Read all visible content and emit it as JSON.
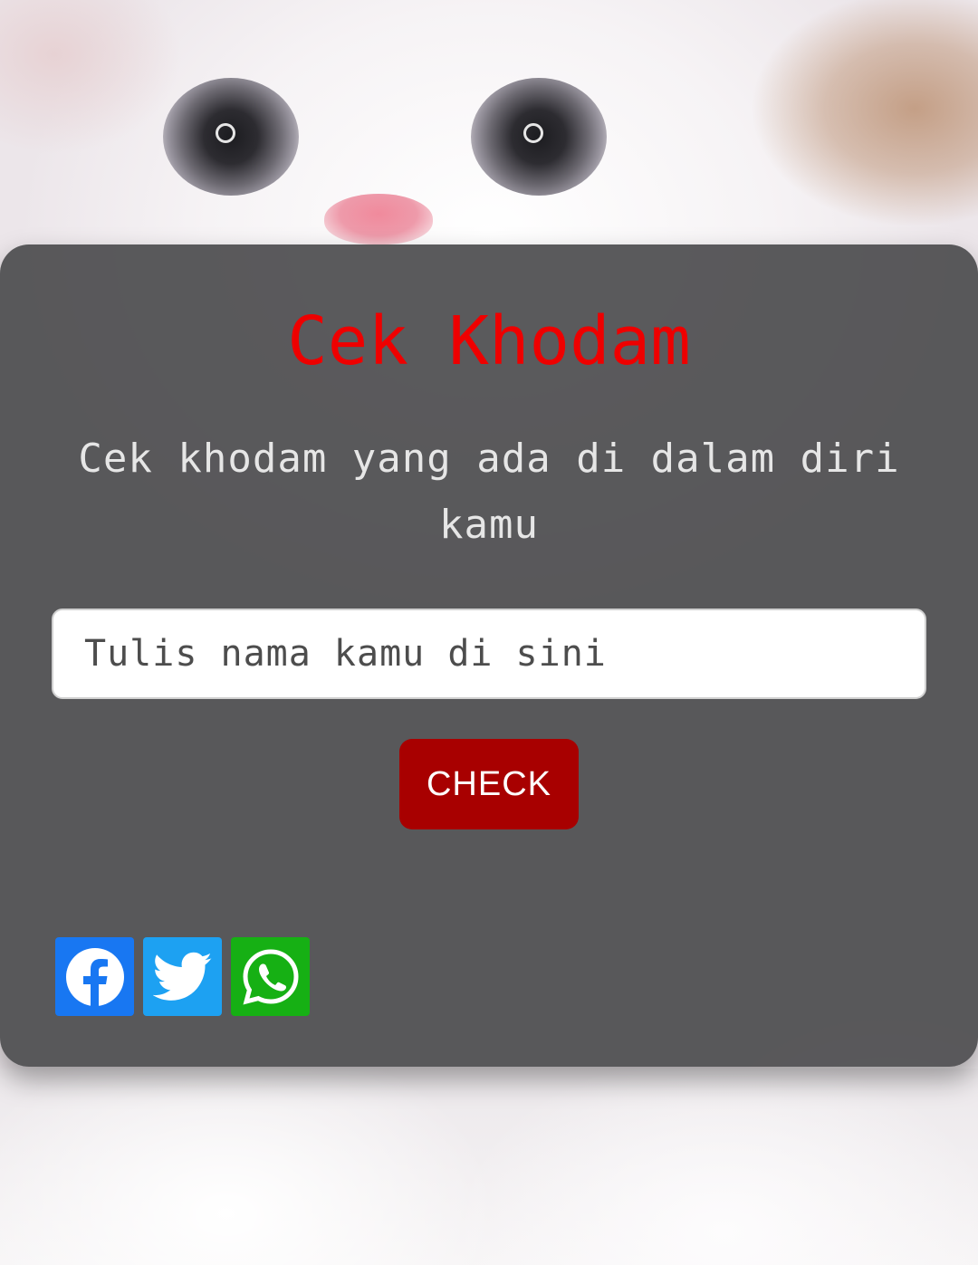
{
  "app": {
    "title": "Cek Khodam",
    "subtitle": "Cek khodam yang ada di dalam diri kamu"
  },
  "form": {
    "input_placeholder": "Tulis nama kamu di sini",
    "input_value": "",
    "check_label": "CHECK"
  },
  "share": {
    "buttons": [
      {
        "icon": "facebook-icon",
        "color": "#1877f2"
      },
      {
        "icon": "twitter-icon",
        "color": "#1da1f2"
      },
      {
        "icon": "whatsapp-icon",
        "color": "#16b014"
      }
    ]
  },
  "colors": {
    "title": "#ee0000",
    "button": "#a80000",
    "card": "#48484a"
  }
}
